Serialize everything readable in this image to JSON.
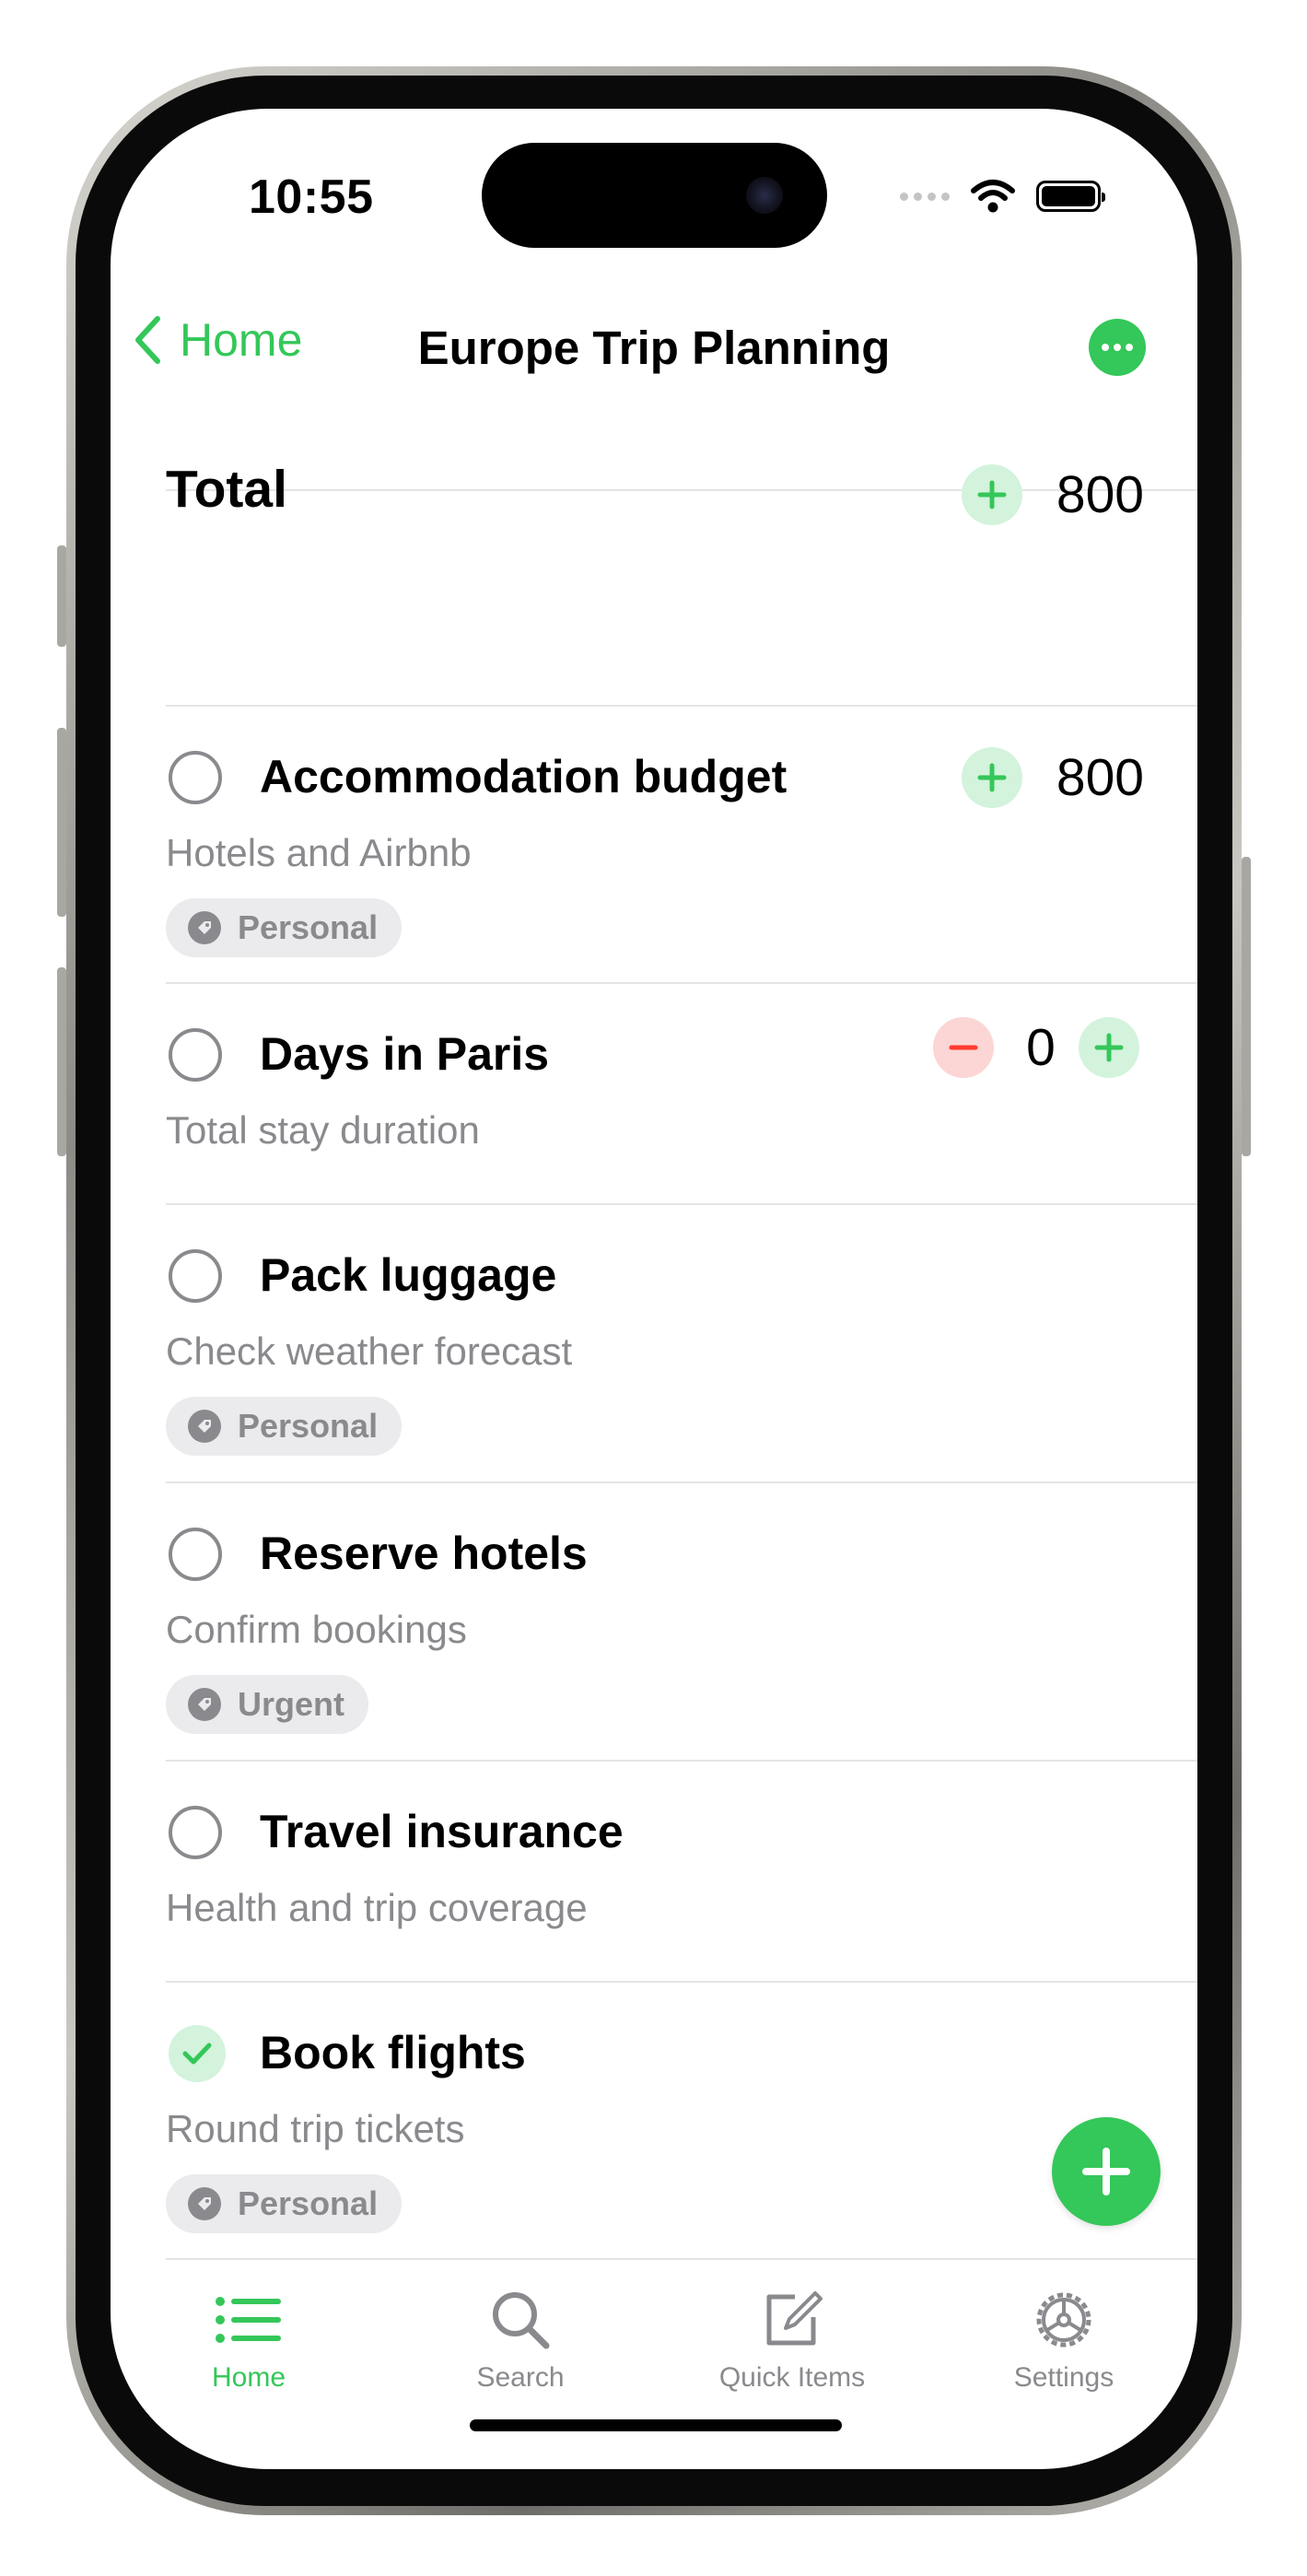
{
  "status_bar": {
    "time": "10:55"
  },
  "nav": {
    "back_label": "Home",
    "title": "Europe Trip Planning"
  },
  "total": {
    "label": "Total",
    "value": "800"
  },
  "items": [
    {
      "title": "Accommodation budget",
      "subtitle": "Hotels and Airbnb",
      "tag": "Personal",
      "value": "800",
      "checked": false
    },
    {
      "title": "Days in Paris",
      "subtitle": "Total stay duration",
      "value": "0",
      "checked": false
    },
    {
      "title": "Pack luggage",
      "subtitle": "Check weather forecast",
      "tag": "Personal",
      "checked": false
    },
    {
      "title": "Reserve hotels",
      "subtitle": "Confirm bookings",
      "tag": "Urgent",
      "checked": false
    },
    {
      "title": "Travel insurance",
      "subtitle": "Health and trip coverage",
      "checked": false
    },
    {
      "title": "Book flights",
      "subtitle": "Round trip tickets",
      "tag": "Personal",
      "checked": true
    }
  ],
  "tabbar": {
    "tabs": [
      {
        "label": "Home",
        "icon": "list-icon",
        "active": true
      },
      {
        "label": "Search",
        "icon": "search-icon",
        "active": false
      },
      {
        "label": "Quick Items",
        "icon": "compose-icon",
        "active": false
      },
      {
        "label": "Settings",
        "icon": "gear-icon",
        "active": false
      }
    ]
  },
  "colors": {
    "accent": "#34c759",
    "minus": "#ff3b30",
    "secondary_text": "#8a8a8e",
    "tag_bg": "#ebebed"
  }
}
